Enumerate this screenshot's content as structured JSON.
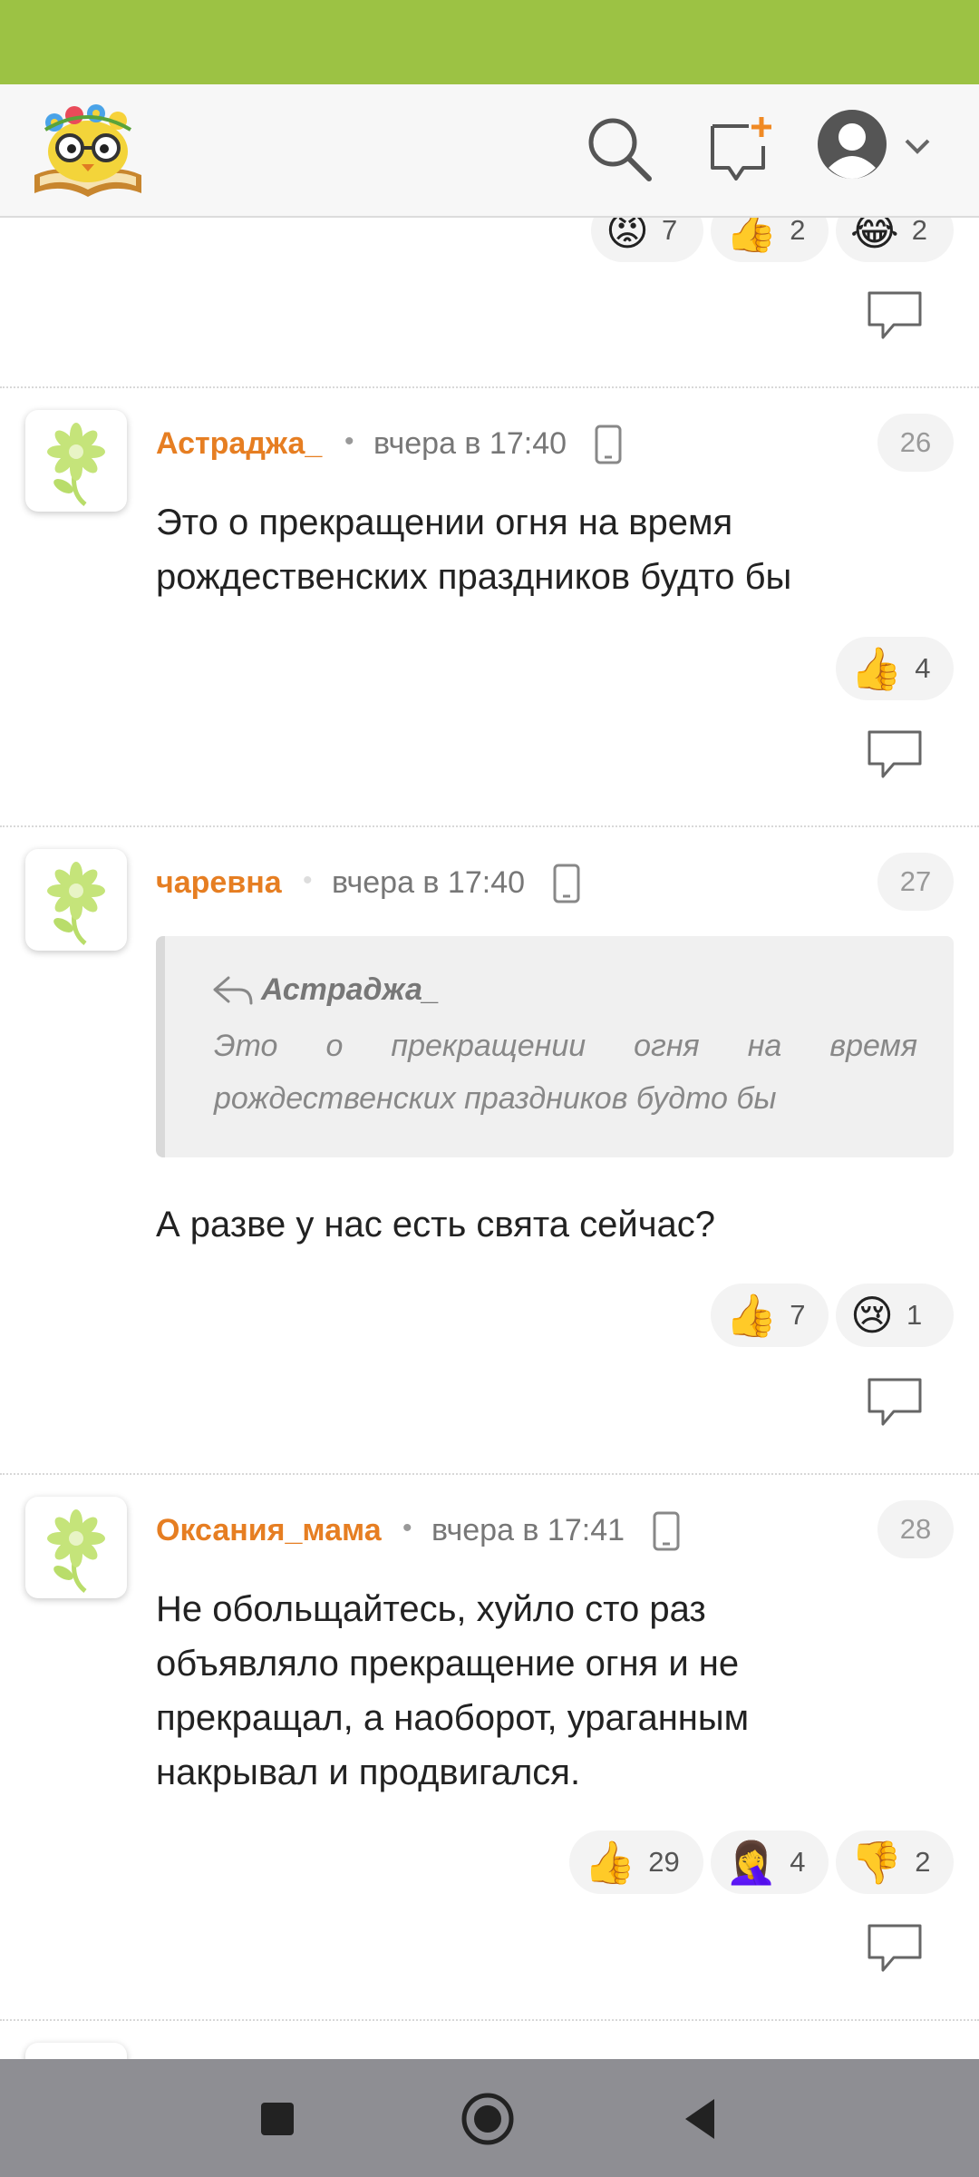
{
  "header": {
    "logo": "owl-book-logo",
    "icons": [
      "search-icon",
      "new-post-icon",
      "profile-avatar-icon",
      "chevron-down-icon"
    ]
  },
  "colors": {
    "status_bar": "#9cc244",
    "author": "#e67e22",
    "header_bg": "#f7f7f7",
    "nav_bar": "#8e8e93"
  },
  "top_reactions": [
    {
      "icon": "😡",
      "count": "7"
    },
    {
      "icon": "👍",
      "count": "2"
    },
    {
      "icon": "😂",
      "count": "2"
    }
  ],
  "comments": [
    {
      "author": "Астраджа_",
      "time": "вчера в 17:40",
      "number": "26",
      "text": "Это о прекращении огня на время рождественских праздников будто бы",
      "reactions": [
        {
          "icon": "👍",
          "count": "4"
        }
      ]
    },
    {
      "author": "чаревна",
      "time": "вчера в 17:40",
      "number": "27",
      "quote": {
        "author": "Астраджа_",
        "text": "Это о прекращении огня на время рождественских праздников будто бы"
      },
      "text": "А разве у нас есть свята сейчас?",
      "reactions": [
        {
          "icon": "👍",
          "count": "7"
        },
        {
          "icon": "😢",
          "count": "1"
        }
      ]
    },
    {
      "author": "Оксания_мама",
      "time": "вчера в 17:41",
      "number": "28",
      "text": "Не обольщайтесь, хуйло сто раз объявляло прекращение огня и не прекращал, а наоборот, ураганным накрывал и продвигался.",
      "reactions": [
        {
          "icon": "👍",
          "count": "29"
        },
        {
          "icon": "🤦‍♀️",
          "count": "4"
        },
        {
          "icon": "👎",
          "count": "2"
        }
      ]
    }
  ],
  "nav": [
    "recent-apps-icon",
    "home-icon",
    "back-icon"
  ]
}
